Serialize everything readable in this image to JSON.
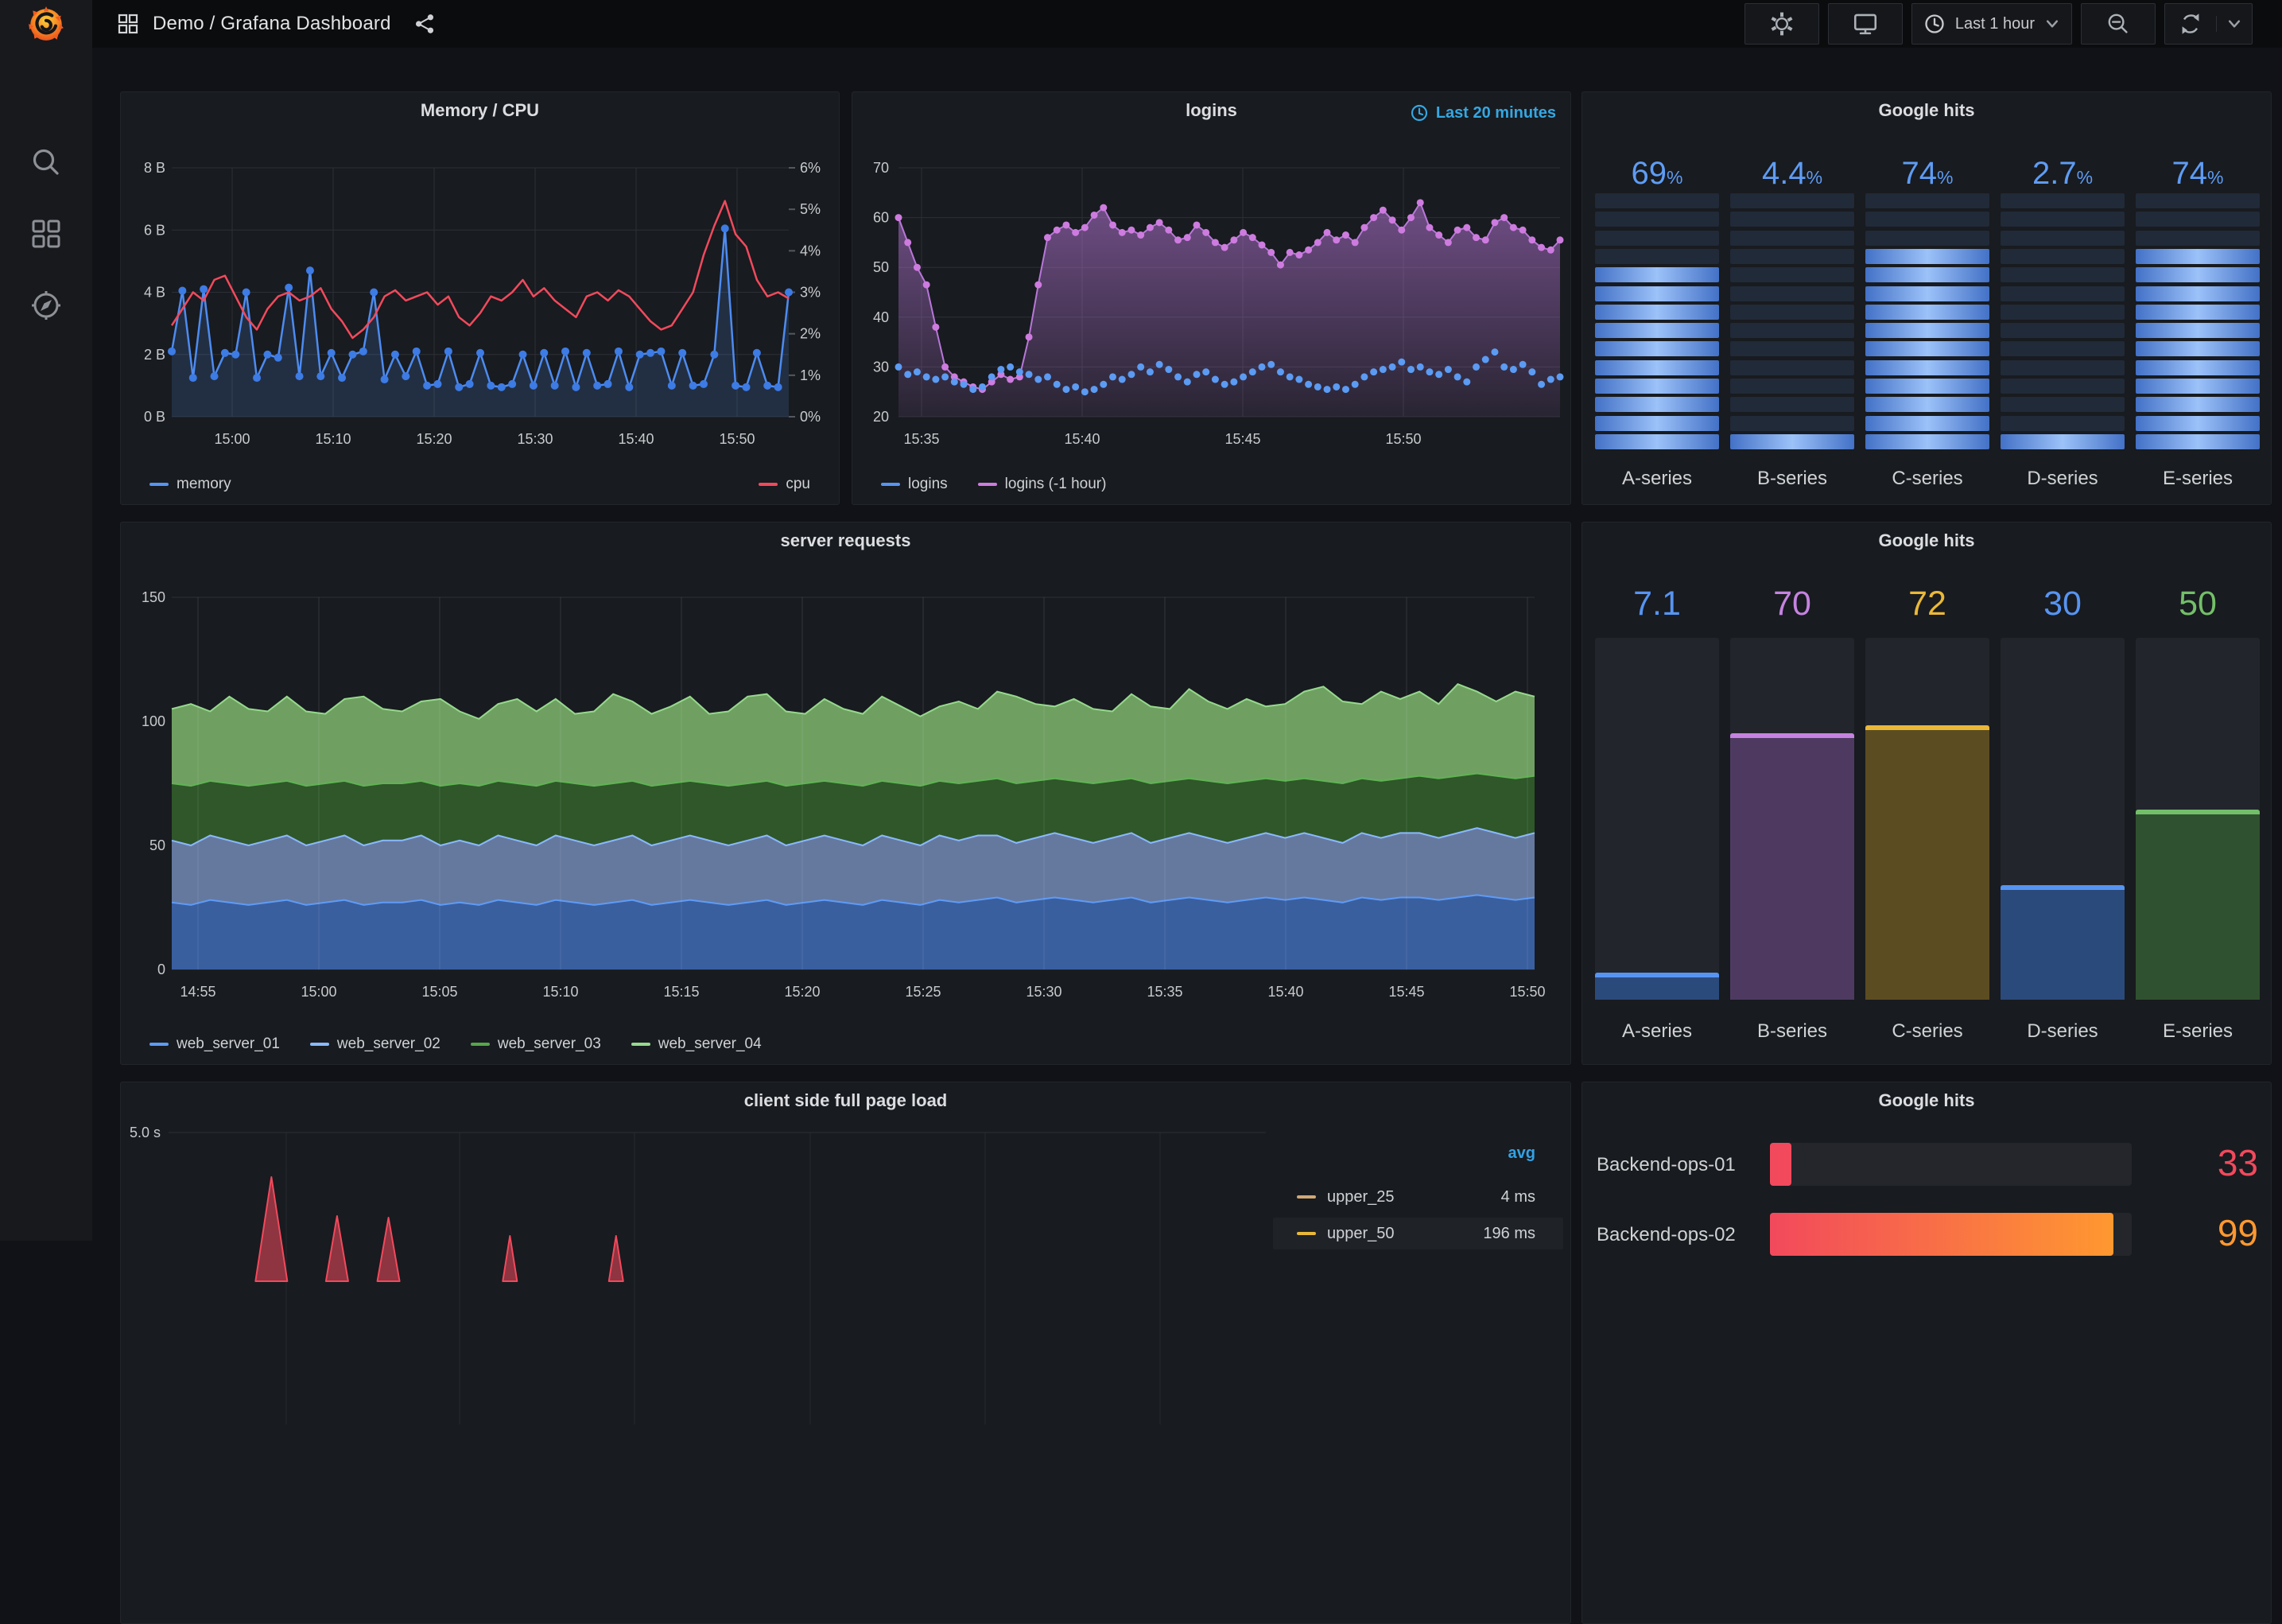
{
  "topnav": {
    "title": "Demo / Grafana Dashboard",
    "time_range_label": "Last 1 hour"
  },
  "sidebar": {
    "icons": [
      "search",
      "apps-grid",
      "compass-explore"
    ]
  },
  "panels": {
    "memcpu": {
      "title": "Memory / CPU",
      "legend": [
        {
          "label": "memory",
          "color": "#5794F2"
        },
        {
          "label": "cpu",
          "color": "#F2495C"
        }
      ]
    },
    "logins": {
      "title": "logins",
      "time_override": "Last 20 minutes",
      "legend": [
        {
          "label": "logins",
          "color": "#5794F2"
        },
        {
          "label": "logins (-1 hour)",
          "color": "#CE7BDF"
        }
      ]
    },
    "gh_led": {
      "title": "Google hits"
    },
    "server": {
      "title": "server requests",
      "legend": [
        {
          "label": "web_server_01",
          "color": "#5E9BF7"
        },
        {
          "label": "web_server_02",
          "color": "#8AB8FF"
        },
        {
          "label": "web_server_03",
          "color": "#56A64B"
        },
        {
          "label": "web_server_04",
          "color": "#96D98D"
        }
      ]
    },
    "gh_bars": {
      "title": "Google hits"
    },
    "pageload": {
      "title": "client side full page load"
    },
    "gh_backend": {
      "title": "Google hits"
    }
  },
  "chart_data": [
    {
      "type": "line",
      "title": "Memory / CPU",
      "x_ticks": [
        "15:00",
        "15:10",
        "15:20",
        "15:30",
        "15:40",
        "15:50"
      ],
      "y_left": {
        "ticks": [
          "8 B",
          "6 B",
          "4 B",
          "2 B",
          "0 B"
        ],
        "min": 0,
        "max": 8
      },
      "y_right": {
        "ticks": [
          "6%",
          "5%",
          "4%",
          "3%",
          "2%",
          "1%",
          "0%"
        ],
        "min": 0,
        "max": 6
      },
      "series": [
        {
          "name": "memory",
          "axis": "left",
          "color": "#4D8BF0",
          "marker_color": "#3D7BE5",
          "values": [
            2.1,
            4.05,
            1.25,
            4.1,
            1.3,
            2.05,
            2.0,
            4.0,
            1.25,
            2.0,
            1.9,
            4.15,
            1.3,
            4.7,
            1.3,
            2.05,
            1.25,
            2.0,
            2.1,
            4.0,
            1.2,
            2.0,
            1.3,
            2.1,
            1.0,
            1.05,
            2.1,
            0.95,
            1.05,
            2.05,
            1.0,
            0.95,
            1.05,
            2.0,
            1.0,
            2.05,
            1.0,
            2.1,
            0.95,
            2.05,
            1.0,
            1.05,
            2.1,
            0.95,
            2.0,
            2.05,
            2.1,
            1.0,
            2.05,
            1.0,
            1.05,
            2.0,
            6.05,
            1.0,
            0.95,
            2.05,
            1.0,
            0.95,
            4.0
          ]
        },
        {
          "name": "cpu",
          "axis": "right",
          "color": "#F2495C",
          "values": [
            2.2,
            2.6,
            3.0,
            2.8,
            3.3,
            3.4,
            2.9,
            2.4,
            2.1,
            2.6,
            2.9,
            3.0,
            2.8,
            2.9,
            3.1,
            2.6,
            2.3,
            1.9,
            2.1,
            2.4,
            2.9,
            3.05,
            2.8,
            2.9,
            3.0,
            2.7,
            2.9,
            2.4,
            2.2,
            2.5,
            2.9,
            2.8,
            3.0,
            3.3,
            2.9,
            3.1,
            2.8,
            2.6,
            2.4,
            2.9,
            3.0,
            2.8,
            3.05,
            2.9,
            2.6,
            2.3,
            2.1,
            2.2,
            2.6,
            3.0,
            3.9,
            4.6,
            5.2,
            4.4,
            4.1,
            3.3,
            2.9,
            3.0,
            2.85
          ]
        }
      ]
    },
    {
      "type": "line",
      "title": "logins",
      "x_ticks": [
        "15:35",
        "15:40",
        "15:45",
        "15:50"
      ],
      "y_left": {
        "ticks": [
          "70",
          "60",
          "50",
          "40",
          "30",
          "20"
        ],
        "min": 20,
        "max": 70
      },
      "series": [
        {
          "name": "logins (-1 hour)",
          "color": "#B877D9",
          "marker_color": "#CE7BDF",
          "area": true,
          "values": [
            60,
            55,
            50,
            46.5,
            38,
            30,
            28,
            27,
            26,
            25.5,
            27,
            28.5,
            27.5,
            28,
            36,
            46.5,
            56,
            57.5,
            58.5,
            57,
            58,
            60.5,
            62,
            58.5,
            57,
            57.5,
            56.5,
            58,
            59,
            57.5,
            55.5,
            56,
            58.5,
            57,
            55,
            54,
            55.5,
            57,
            56,
            54.5,
            53,
            50.5,
            53,
            52.5,
            53.5,
            55,
            57,
            55.5,
            56.5,
            55,
            58,
            60,
            61.5,
            59.5,
            57.5,
            60,
            63,
            58,
            56.5,
            55,
            57.5,
            58,
            56,
            55.5,
            59,
            60,
            58,
            57.5,
            55.5,
            54,
            53.5,
            55.5
          ]
        },
        {
          "name": "logins",
          "color": "#5B9BF3",
          "markers_only": true,
          "values": [
            30,
            28.5,
            29,
            28,
            27.5,
            28,
            27,
            26.5,
            25.5,
            26,
            28,
            29.5,
            30,
            29,
            28.5,
            27.5,
            28,
            26.5,
            25.5,
            26,
            25,
            25.5,
            26.5,
            28,
            27.5,
            28.5,
            30,
            29,
            30.5,
            29.5,
            28,
            27,
            28.5,
            29,
            27.5,
            26.5,
            27,
            28,
            29,
            30,
            30.5,
            29,
            28,
            27.5,
            26.5,
            26,
            25.5,
            26,
            25.5,
            26.5,
            28,
            29,
            29.5,
            30,
            31,
            29.5,
            30,
            29,
            28.5,
            29.5,
            28,
            27,
            30,
            31.5,
            33,
            30,
            29.5,
            30.5,
            29,
            26.5,
            27.5,
            28
          ]
        }
      ]
    },
    {
      "type": "bar",
      "subtype": "led-gauge",
      "title": "Google hits",
      "categories": [
        "A-series",
        "B-series",
        "C-series",
        "D-series",
        "E-series"
      ],
      "values": [
        69,
        4.4,
        74,
        2.7,
        74
      ],
      "display": [
        "69",
        "4.4",
        "74",
        "2.7",
        "74"
      ],
      "suffix": "%",
      "segments_total": 14,
      "segments_lit": [
        10,
        1,
        11,
        1,
        11
      ],
      "value_color": "#5e9cf5"
    },
    {
      "type": "area",
      "stacked": true,
      "title": "server requests",
      "x_ticks": [
        "14:55",
        "15:00",
        "15:05",
        "15:10",
        "15:15",
        "15:20",
        "15:25",
        "15:30",
        "15:35",
        "15:40",
        "15:45",
        "15:50"
      ],
      "y_left": {
        "ticks": [
          "150",
          "100",
          "50",
          "0"
        ],
        "min": 0,
        "max": 150
      },
      "series": [
        {
          "name": "web_server_01",
          "line": "#5E9BF7",
          "fill": "#3a5f9f",
          "values": [
            27,
            26,
            28,
            27,
            26,
            27,
            28,
            26,
            27,
            28,
            26,
            27,
            27,
            28,
            26,
            27,
            26,
            28,
            27,
            26,
            28,
            27,
            26,
            27,
            28,
            26,
            27,
            28,
            27,
            26,
            27,
            28,
            26,
            27,
            28,
            27,
            26,
            28,
            27,
            26,
            28,
            27,
            28,
            29,
            27,
            28,
            29,
            28,
            27,
            28,
            29,
            27,
            28,
            29,
            28,
            27,
            28,
            29,
            28,
            29,
            28,
            27,
            29,
            28,
            29,
            29,
            28,
            29,
            30,
            29,
            28,
            29
          ]
        },
        {
          "name": "web_server_02",
          "line": "#8AB8FF",
          "fill": "#65799f",
          "values": [
            25,
            24,
            26,
            25,
            24,
            25,
            26,
            24,
            25,
            26,
            24,
            25,
            25,
            26,
            24,
            25,
            24,
            26,
            25,
            24,
            26,
            25,
            24,
            25,
            26,
            24,
            25,
            26,
            25,
            24,
            25,
            26,
            24,
            25,
            26,
            25,
            24,
            26,
            25,
            24,
            26,
            25,
            26,
            25,
            24,
            25,
            26,
            25,
            24,
            25,
            26,
            24,
            25,
            26,
            25,
            24,
            25,
            26,
            25,
            26,
            25,
            24,
            26,
            25,
            26,
            26,
            25,
            26,
            27,
            26,
            25,
            26
          ]
        },
        {
          "name": "web_server_03",
          "line": "#5FB354",
          "fill": "#2f5729",
          "values": [
            23,
            24,
            22,
            23,
            24,
            23,
            22,
            24,
            23,
            22,
            24,
            23,
            23,
            22,
            24,
            23,
            24,
            22,
            23,
            24,
            22,
            23,
            24,
            23,
            22,
            24,
            23,
            22,
            23,
            24,
            23,
            22,
            24,
            23,
            22,
            23,
            24,
            22,
            23,
            24,
            22,
            23,
            22,
            23,
            24,
            23,
            22,
            23,
            24,
            23,
            22,
            24,
            23,
            22,
            23,
            24,
            23,
            22,
            23,
            22,
            23,
            24,
            22,
            23,
            22,
            23,
            24,
            23,
            22,
            23,
            24,
            23
          ]
        },
        {
          "name": "web_server_04",
          "line": "#96D98D",
          "fill": "#6fa061",
          "values": [
            30,
            33,
            28,
            35,
            31,
            29,
            34,
            30,
            28,
            33,
            36,
            30,
            29,
            32,
            35,
            29,
            27,
            31,
            34,
            30,
            33,
            28,
            30,
            36,
            32,
            29,
            31,
            34,
            28,
            30,
            35,
            35,
            30,
            28,
            33,
            30,
            29,
            34,
            31,
            28,
            30,
            33,
            29,
            35,
            35,
            31,
            29,
            33,
            30,
            28,
            34,
            31,
            29,
            36,
            32,
            30,
            33,
            29,
            31,
            35,
            38,
            33,
            30,
            36,
            32,
            34,
            30,
            37,
            33,
            30,
            35,
            32
          ]
        }
      ]
    },
    {
      "type": "bar",
      "subtype": "vertical-gauge",
      "title": "Google hits",
      "categories": [
        "A-series",
        "B-series",
        "C-series",
        "D-series",
        "E-series"
      ],
      "values": [
        7.1,
        70,
        72,
        30,
        50
      ],
      "display": [
        "7.1",
        "70",
        "72",
        "30",
        "50"
      ],
      "scale_max": 95,
      "colors": [
        "#5794F2",
        "#C583E0",
        "#EAB839",
        "#5794F2",
        "#73BF69"
      ],
      "fill_dim": [
        "#2b4a7c",
        "#4e3a61",
        "#5c4c22",
        "#2b4a7c",
        "#30512f"
      ]
    },
    {
      "type": "line",
      "title": "client side full page load",
      "y_label_top": "5.0 s",
      "series_color": "#F2495C",
      "spikes": {
        "x_frac": [
          0.094,
          0.154,
          0.201,
          0.312,
          0.409
        ],
        "peak_seconds": [
          4.1,
          3.3,
          3.27,
          2.9,
          2.9
        ]
      },
      "legend_table": {
        "header": "avg",
        "rows": [
          {
            "label": "upper_25",
            "color": "#D0A878",
            "value": "4 ms",
            "highlight": false
          },
          {
            "label": "upper_50",
            "color": "#EAB839",
            "value": "196 ms",
            "highlight": true
          }
        ]
      }
    },
    {
      "type": "bar",
      "subtype": "horizontal-gauge",
      "title": "Google hits",
      "rows": [
        {
          "label": "Backend-ops-01",
          "value": "33",
          "color": "#F2495C",
          "fill_frac": 0.06,
          "gradient": false
        },
        {
          "label": "Backend-ops-02",
          "value": "99",
          "color": "#FF9830",
          "fill_frac": 0.95,
          "gradient": true
        }
      ]
    }
  ]
}
